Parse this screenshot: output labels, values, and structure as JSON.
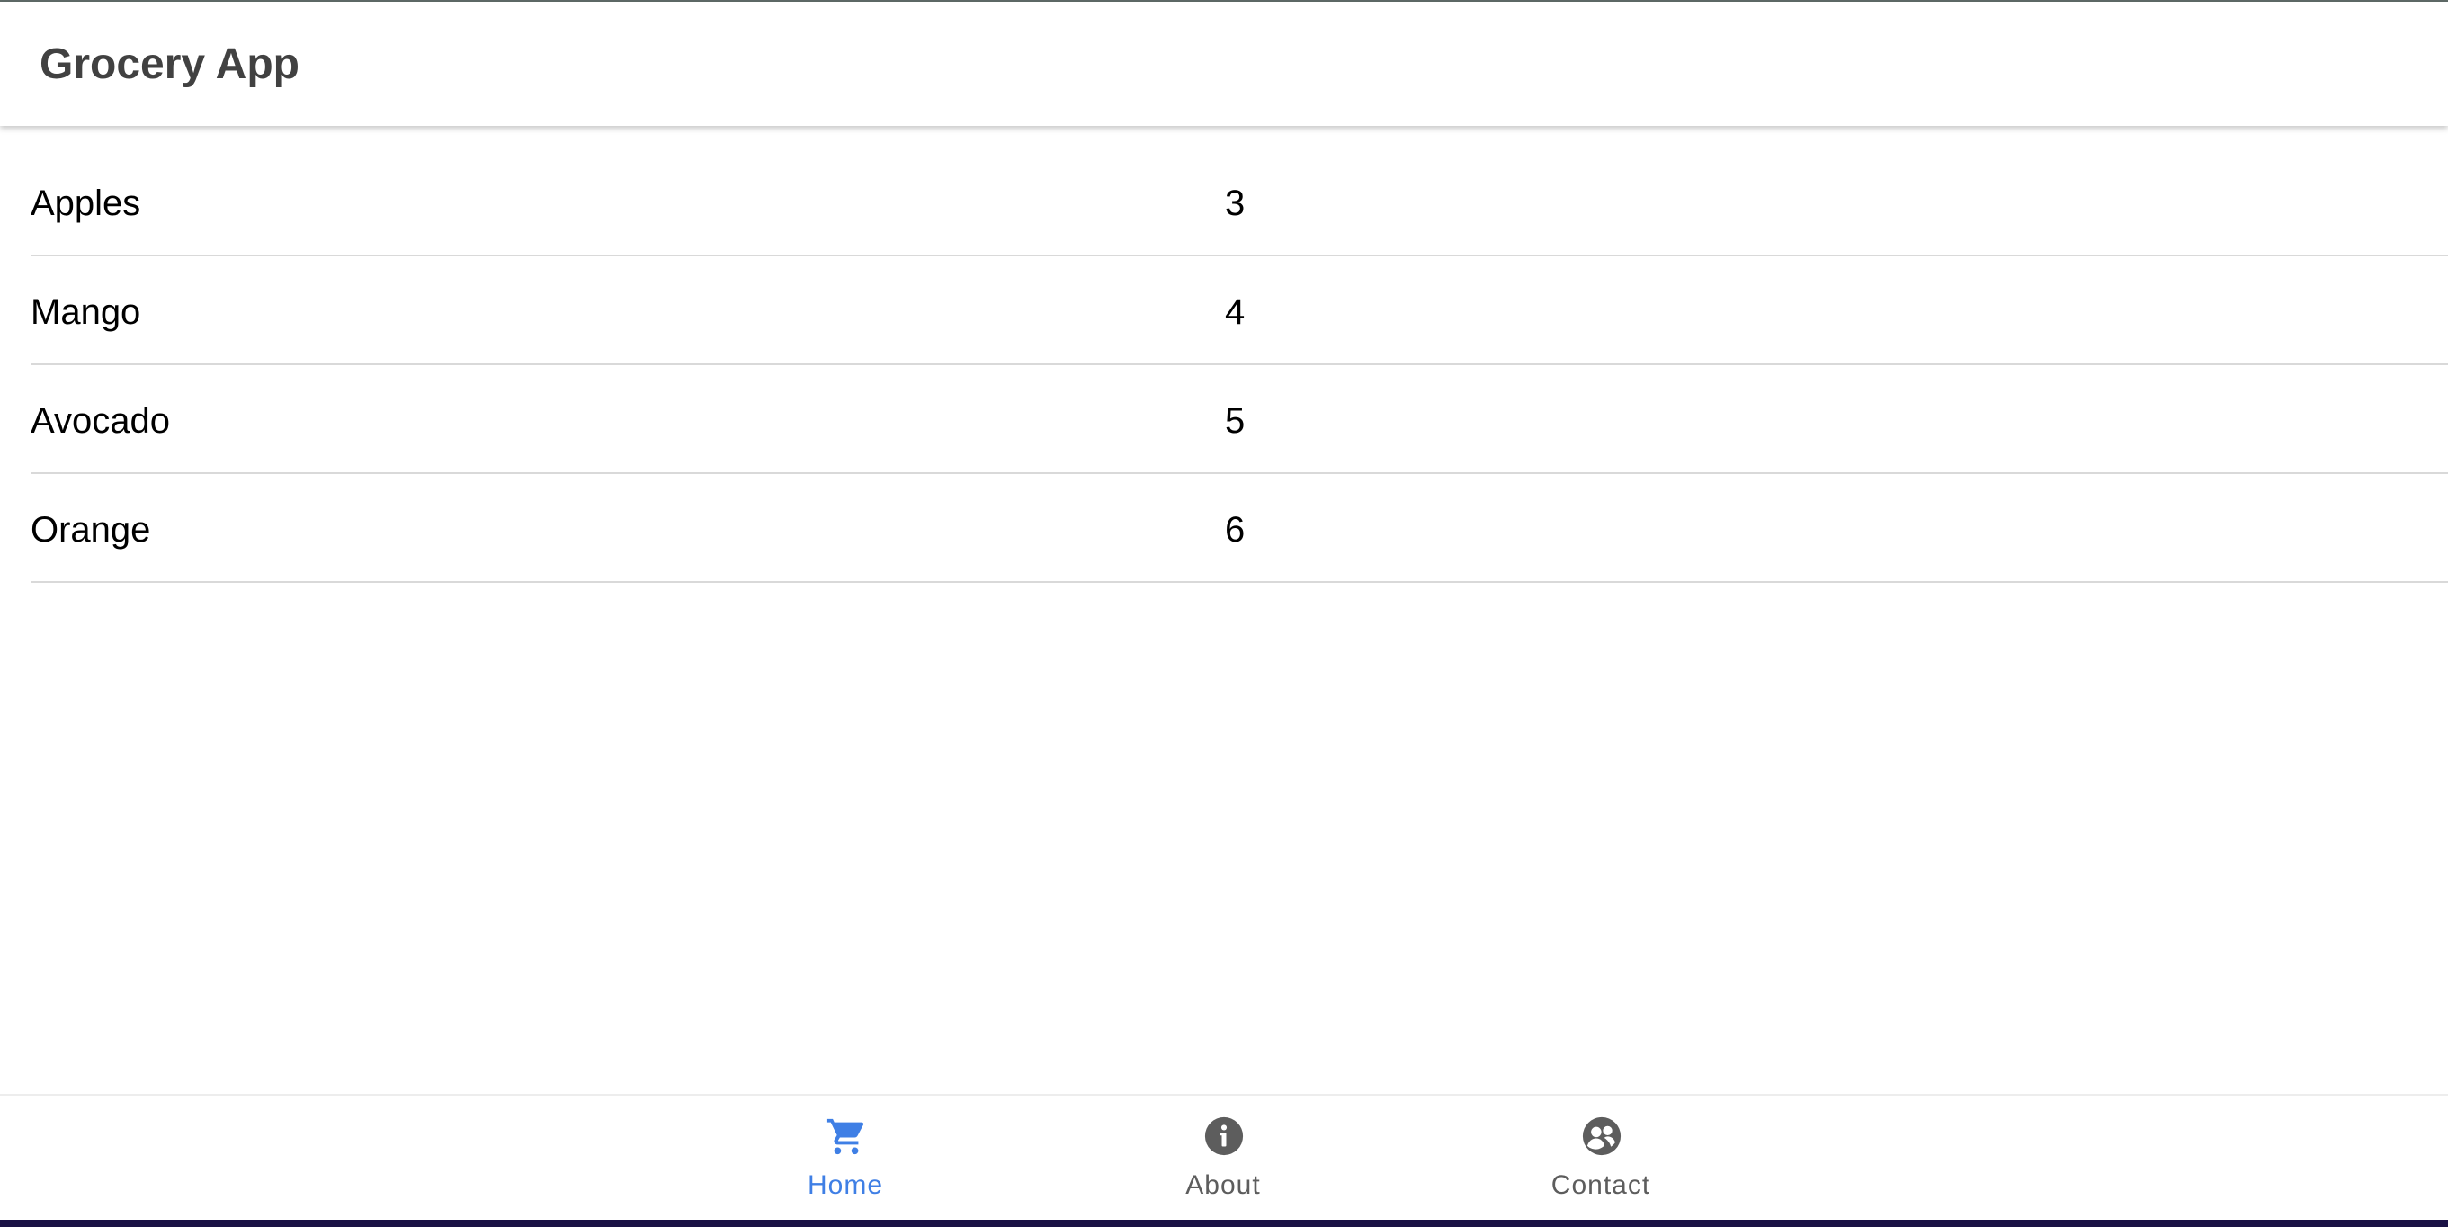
{
  "app": {
    "title": "Grocery App"
  },
  "items": [
    {
      "name": "Apples",
      "quantity": "3"
    },
    {
      "name": "Mango",
      "quantity": "4"
    },
    {
      "name": "Avocado",
      "quantity": "5"
    },
    {
      "name": "Orange",
      "quantity": "6"
    }
  ],
  "bottom_nav": {
    "items": [
      {
        "label": "Home",
        "icon": "cart-icon",
        "active": true
      },
      {
        "label": "About",
        "icon": "info-icon",
        "active": false
      },
      {
        "label": "Contact",
        "icon": "contact-icon",
        "active": false
      }
    ]
  },
  "colors": {
    "active": "#3f7fe5",
    "inactive": "#5d5d5d",
    "title": "#414141"
  }
}
